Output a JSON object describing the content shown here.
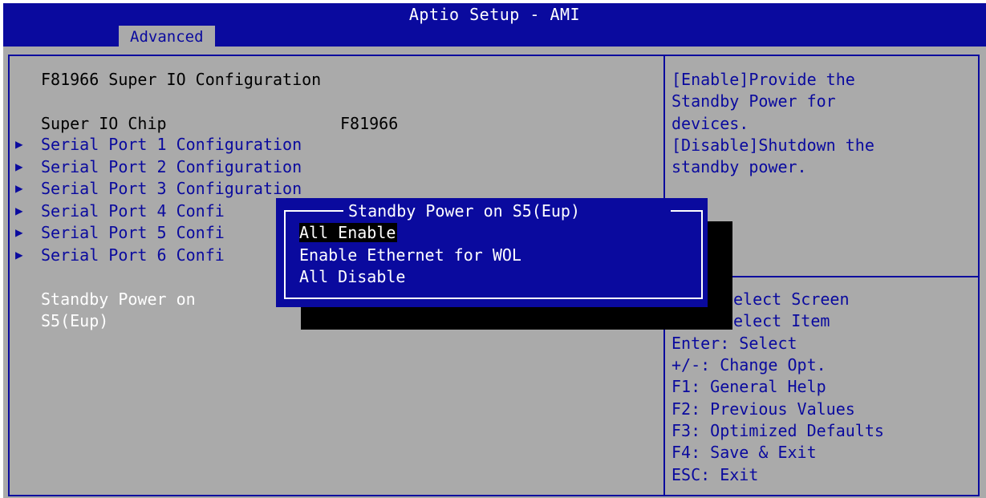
{
  "header": {
    "title": "Aptio Setup - AMI",
    "active_tab": "Advanced"
  },
  "main": {
    "section_title": "F81966 Super IO Configuration",
    "chip_label": "Super IO Chip",
    "chip_value": "F81966",
    "submenus": [
      {
        "label": "Serial Port 1 Configuration"
      },
      {
        "label": "Serial Port 2 Configuration"
      },
      {
        "label": "Serial Port 3 Configuration"
      },
      {
        "label": "Serial Port 4 Confi"
      },
      {
        "label": "Serial Port 5 Confi"
      },
      {
        "label": "Serial Port 6 Confi"
      }
    ],
    "standby_label_line1": "Standby Power on",
    "standby_label_line2": "S5(Eup)"
  },
  "popup": {
    "title": "Standby Power on S5(Eup)",
    "options": [
      {
        "label": "All Enable",
        "selected": true
      },
      {
        "label": "Enable Ethernet for WOL",
        "selected": false
      },
      {
        "label": "All Disable",
        "selected": false
      }
    ]
  },
  "help": {
    "lines": [
      "[Enable]Provide the",
      "Standby Power for",
      "devices.",
      "[Disable]Shutdown the",
      "standby power."
    ]
  },
  "keys": {
    "lines": [
      "elect Screen",
      "elect Item",
      "Enter: Select",
      "+/-: Change Opt.",
      "F1: General Help",
      "F2: Previous Values",
      "F3: Optimized Defaults",
      "F4: Save & Exit",
      "ESC: Exit"
    ]
  },
  "colors": {
    "header_bg": "#0a0a9e",
    "body_bg": "#aaaaaa",
    "text_blue": "#0a0a9e",
    "highlight_bg": "#000000"
  }
}
